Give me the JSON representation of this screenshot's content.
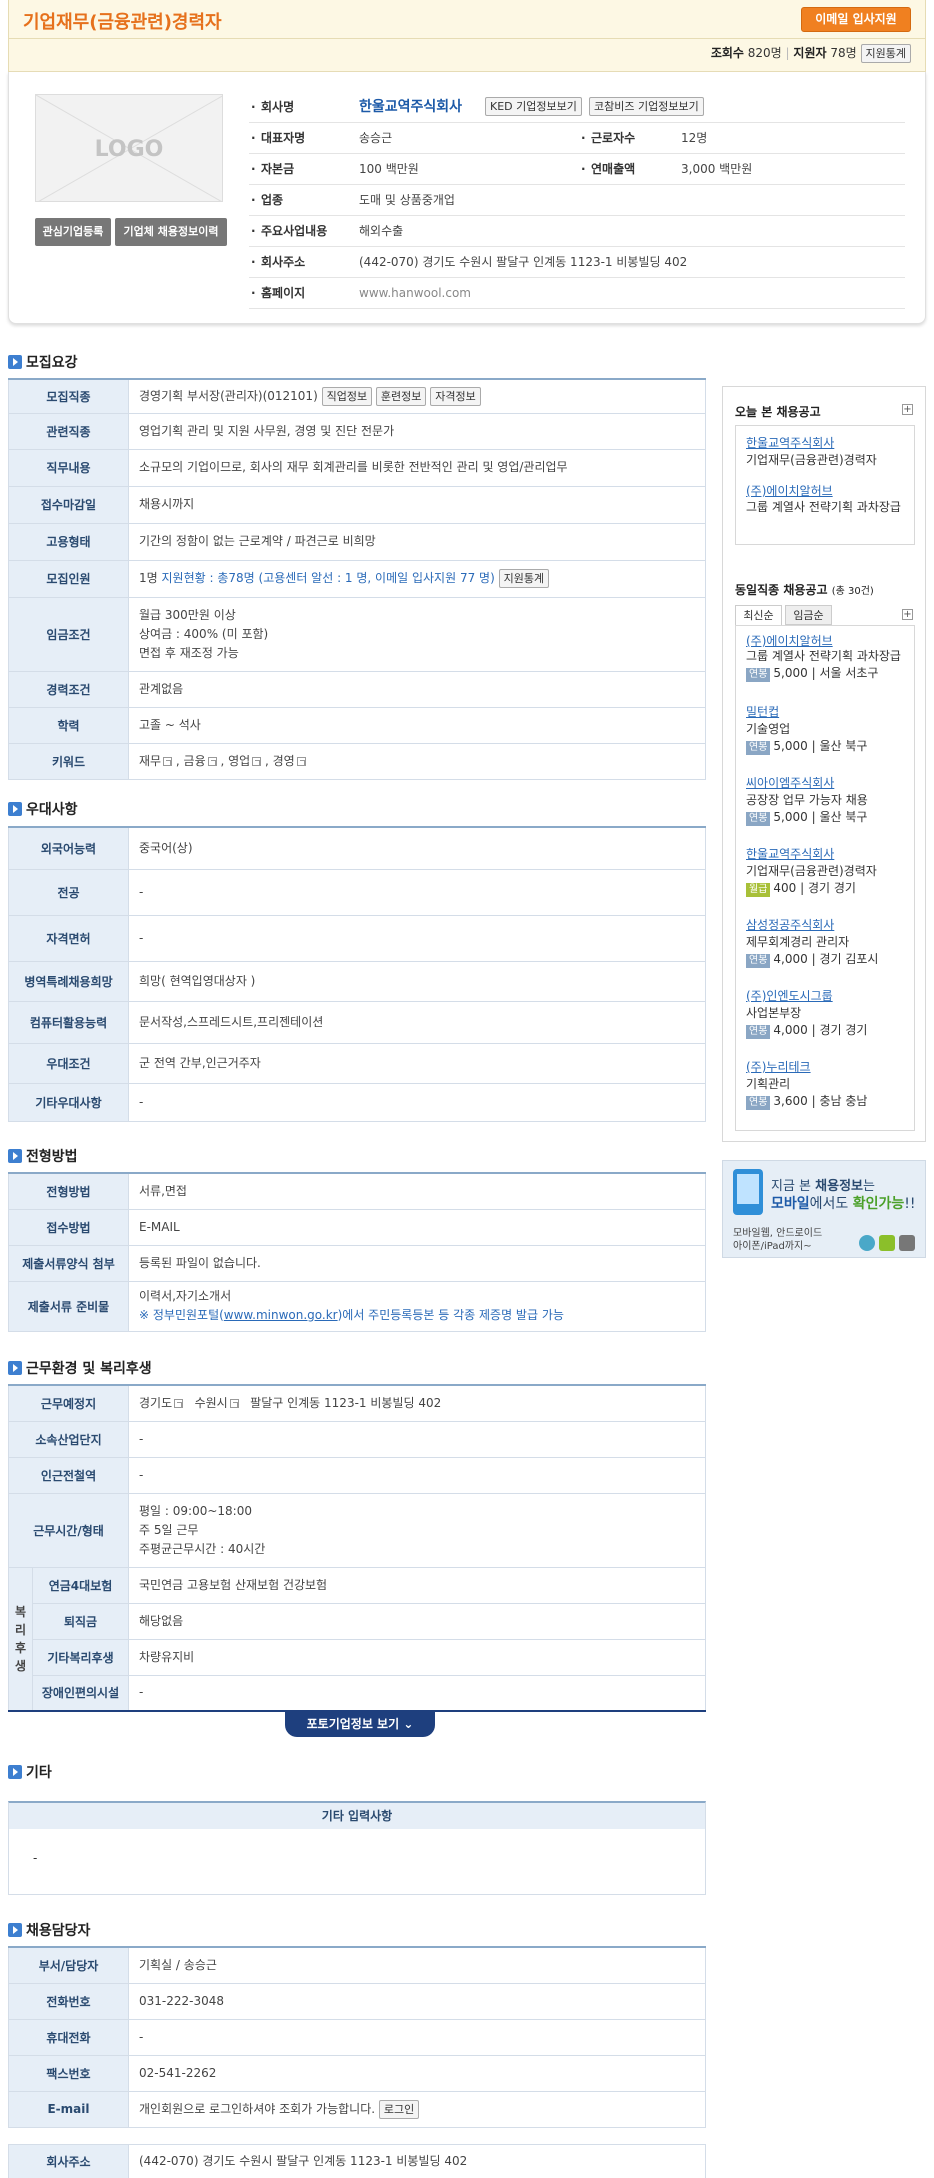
{
  "header": {
    "title": "기업재무(금융관련)경력자",
    "apply_button": "이메일 입사지원",
    "views_label": "조회수",
    "views_value": "820명",
    "applicants_label": "지원자",
    "applicants_value": "78명",
    "stats_button": "지원통계"
  },
  "company": {
    "logo_text": "LOGO",
    "interest_button": "관심기업등록",
    "history_button": "기업체 채용정보이력",
    "name_label": "회사명",
    "name": "한울교역주식회사",
    "ked_button": "KED 기업정보보기",
    "cobiz_button": "코참비즈 기업정보보기",
    "ceo_label": "대표자명",
    "ceo": "송승근",
    "employees_label": "근로자수",
    "employees": "12명",
    "capital_label": "자본금",
    "capital": "100 백만원",
    "sales_label": "연매출액",
    "sales": "3,000 백만원",
    "industry_label": "업종",
    "industry": "도매 및 상품중개업",
    "business_label": "주요사업내용",
    "business": "해외수출",
    "address_label": "회사주소",
    "address": "(442-070) 경기도 수원시 팔달구 인계동 1123-1 비봉빌딩 402",
    "homepage_label": "홈페이지",
    "homepage": "www.hanwool.com"
  },
  "recruit": {
    "section_title": "모집요강",
    "job_label": "모집직종",
    "job": "경영기획 부서장(관리자)(012101)",
    "job_btn1": "직업정보",
    "job_btn2": "훈련정보",
    "job_btn3": "자격정보",
    "related_label": "관련직종",
    "related": "영업기획 관리 및 지원 사무원, 경영 및 진단 전문가",
    "duty_label": "직무내용",
    "duty": "소규모의 기업이므로, 회사의 재무 회계관리를 비롯한 전반적인 관리 및 영업/관리업무",
    "deadline_label": "접수마감일",
    "deadline": "채용시까지",
    "employ_label": "고용형태",
    "employ": "기간의 정함이 없는 근로계약 / 파견근로 비희망",
    "count_label": "모집인원",
    "count_a": "1명",
    "count_b": "지원현황 : 총78명 (고용센터 알선 : 1 명, 이메일 입사지원 77 명)",
    "count_btn": "지원통계",
    "wage_label": "임금조건",
    "wage1": "월급 300만원 이상",
    "wage2": "상여금 : 400% (미 포함)",
    "wage3": "면접 후 재조정 가능",
    "career_label": "경력조건",
    "career": "관계없음",
    "edu_label": "학력",
    "edu": "고졸 ~ 석사",
    "kw_label": "키워드",
    "kw1": "재무",
    "kw2": "금융",
    "kw3": "영업",
    "kw4": "경영"
  },
  "pref": {
    "section_title": "우대사항",
    "lang_label": "외국어능력",
    "lang": "중국어(상)",
    "major_label": "전공",
    "major": "-",
    "license_label": "자격면허",
    "license": "-",
    "military_label": "병역특례채용희망",
    "military": "희망( 현역입영대상자 )",
    "computer_label": "컴퓨터활용능력",
    "computer": "문서작성,스프레드시트,프리젠테이션",
    "cond_label": "우대조건",
    "cond": "군 전역 간부,인근거주자",
    "etc_label": "기타우대사항",
    "etc": "-"
  },
  "screening": {
    "section_title": "전형방법",
    "method_label": "전형방법",
    "method": "서류,면접",
    "receipt_label": "접수방법",
    "receipt": "E-MAIL",
    "form_label": "제출서류양식 첨부",
    "form": "등록된 파일이 없습니다.",
    "docs_label": "제출서류 준비물",
    "docs": "이력서,자기소개서",
    "docs_note_a": "※ 정부민원포털(",
    "docs_note_link": "www.minwon.go.kr",
    "docs_note_b": ")에서 주민등록등본 등 각종 제증명 발급 가능"
  },
  "work": {
    "section_title": "근무환경 및 복리후생",
    "place_label": "근무예정지",
    "place_a": "경기도",
    "place_b": "수원시",
    "place_c": "팔달구 인계동 1123-1 비봉빌딩 402",
    "complex_label": "소속산업단지",
    "complex": "-",
    "station_label": "인근전철역",
    "station": "-",
    "hours_label": "근무시간/형태",
    "hours1": "평일 : 09:00~18:00",
    "hours2": "주 5일 근무",
    "hours3": "주평균근무시간 : 40시간",
    "welfare_side": "복리후생",
    "ins_label": "연금4대보험",
    "ins": "국민연금 고용보험 산재보험 건강보험",
    "sev_label": "퇴직금",
    "sev": "해당없음",
    "wel_label": "기타복리후생",
    "wel": "차량유지비",
    "dis_label": "장애인편의시설",
    "dis": "-",
    "photo_button": "포토기업정보 보기"
  },
  "other": {
    "section_title": "기타",
    "box_title": "기타 입력사항",
    "box_value": "-"
  },
  "contact": {
    "section_title": "채용담당자",
    "dept_label": "부서/담당자",
    "dept": "기획실 / 송승근",
    "phone_label": "전화번호",
    "phone": "031-222-3048",
    "mobile_label": "휴대전화",
    "mobile": "-",
    "fax_label": "팩스번호",
    "fax": "02-541-2262",
    "email_label": "E-mail",
    "email": "개인회원으로 로그인하셔야 조회가 가능합니다.",
    "login_button": "로그인",
    "addr_label": "회사주소",
    "addr": "(442-070) 경기도 수원시 팔달구 인계동 1123-1 비봉빌딩 402"
  },
  "sidebar": {
    "today_title": "오늘 본 채용공고",
    "today": [
      {
        "company": "한울교역주식회사",
        "title": "기업재무(금융관련)경력자"
      },
      {
        "company": "(주)에이치알허브",
        "title": "그룹 계열사 전략기획 과차장급"
      }
    ],
    "same_title": "동일직종 채용공고",
    "same_count": "(총 30건)",
    "tab_latest": "최신순",
    "tab_wage": "임금순",
    "same": [
      {
        "company": "(주)에이치알허브",
        "title": "그룹 계열사 전략기획 과차장급",
        "tag": "연봉",
        "pay": "5,000",
        "region": "서울 서초구"
      },
      {
        "company": "밀턴컵",
        "title": "기술영업",
        "tag": "연봉",
        "pay": "5,000",
        "region": "울산 북구"
      },
      {
        "company": "씨아이엠주식회사",
        "title": "공장장 업무 가능자 채용",
        "tag": "연봉",
        "pay": "5,000",
        "region": "울산 북구"
      },
      {
        "company": "한울교역주식회사",
        "title": "기업재무(금융관련)경력자",
        "tag": "월급",
        "pay": "400",
        "region": "경기 경기"
      },
      {
        "company": "삼성정공주식회사",
        "title": "제무회계경리 관리자",
        "tag": "연봉",
        "pay": "4,000",
        "region": "경기 김포시"
      },
      {
        "company": "(주)인엔도시그룹",
        "title": "사업본부장",
        "tag": "연봉",
        "pay": "4,000",
        "region": "경기 경기"
      },
      {
        "company": "(주)누리테크",
        "title": "기획관리",
        "tag": "연봉",
        "pay": "3,600",
        "region": "충남 충남"
      }
    ],
    "mobile_line1a": "지금 본 ",
    "mobile_line1b": "채용정보",
    "mobile_line1c": "는",
    "mobile_line2a": "모바일",
    "mobile_line2b": "에서도 ",
    "mobile_line2c": "확인가능",
    "mobile_line2d": "!!",
    "mobile_sub1": "모바일웹, 안드로이드",
    "mobile_sub2": "아이폰/iPad까지~"
  }
}
